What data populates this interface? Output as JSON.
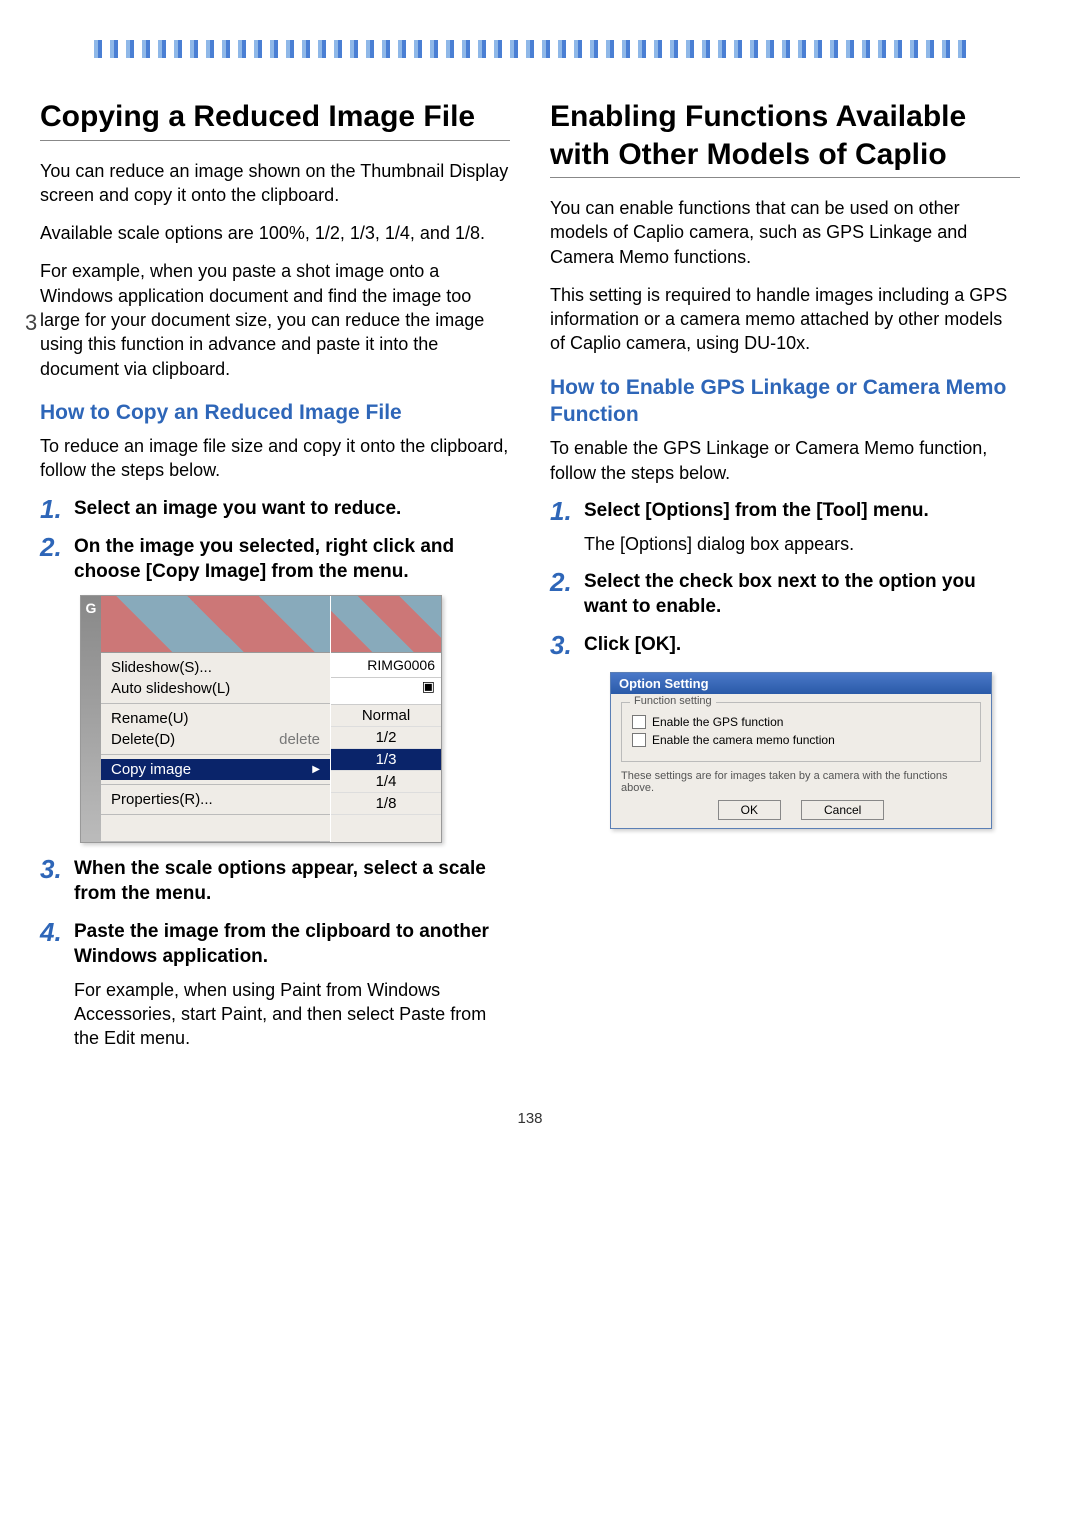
{
  "page_number": "138",
  "section_tab": "3",
  "left": {
    "title": "Copying a Reduced Image File",
    "p1": "You can reduce an image shown on the Thumbnail Display screen and copy it onto the clipboard.",
    "p2": "Available scale options are 100%, 1/2, 1/3, 1/4, and 1/8.",
    "p3": "For example, when you paste a shot image onto a Windows application document and find the image too large for your document size, you can reduce the image using this function in advance and paste it into the document via clipboard.",
    "h2": "How to Copy an Reduced Image File",
    "p4": "To reduce an image file size and copy it onto the clipboard, follow the steps below.",
    "steps": {
      "s1": "Select an image you want to reduce.",
      "s2": "On the image you selected, right click and choose [Copy Image] from the menu.",
      "s3": "When the scale options appear, select a scale from the menu.",
      "s4": "Paste the image from the clipboard to another Windows application.",
      "s4_body": "For example, when using Paint from Windows Accessories, start Paint, and then select Paste from the Edit menu."
    },
    "fig1": {
      "sidebar": "G",
      "menu": {
        "slideshow": "Slideshow(S)...",
        "auto_slideshow": "Auto slideshow(L)",
        "rename": "Rename(U)",
        "delete": "Delete(D)",
        "delete_hint": "delete",
        "copy_image": "Copy image",
        "properties": "Properties(R)..."
      },
      "image_name": "RIMG0006",
      "submenu": {
        "normal": "Normal",
        "half": "1/2",
        "third": "1/3",
        "quarter": "1/4",
        "eighth": "1/8"
      }
    }
  },
  "right": {
    "title": "Enabling Functions Available with Other Models of Caplio",
    "p1": "You can enable functions that can be used on other models of Caplio camera, such as GPS Linkage and Camera Memo functions.",
    "p2": "This setting is required to handle images including a GPS information or a camera memo attached by other models of Caplio camera, using DU-10x.",
    "h2": "How to Enable GPS Linkage or Camera Memo Function",
    "p3": "To enable the GPS Linkage or Camera Memo function, follow the steps below.",
    "steps": {
      "s1": "Select [Options] from the  [Tool] menu.",
      "s1_body": "The [Options] dialog box appears.",
      "s2": "Select the check box next to the option you want to enable.",
      "s3": "Click [OK]."
    },
    "fig2": {
      "title": "Option Setting",
      "group_legend": "Function setting",
      "chk_gps": "Enable the GPS function",
      "chk_memo": "Enable the camera memo function",
      "note": "These settings are for images taken by a camera with the functions above.",
      "ok": "OK",
      "cancel": "Cancel"
    }
  }
}
